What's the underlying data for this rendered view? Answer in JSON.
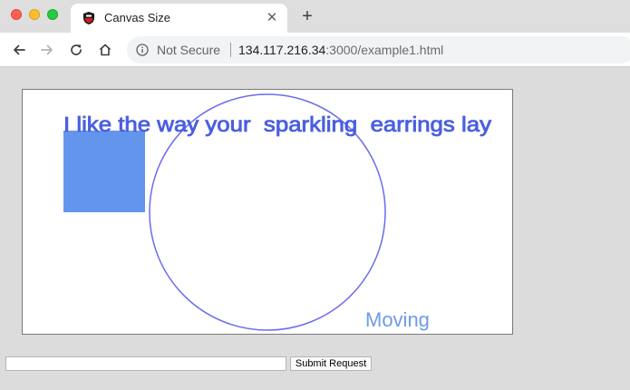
{
  "browser": {
    "tab_title": "Canvas Size",
    "tab_close_glyph": "✕",
    "new_tab_glyph": "+",
    "security_label": "Not Secure",
    "url_host": "134.117.216.34",
    "url_rest": ":3000/example1.html"
  },
  "canvas": {
    "caption_text": "I like the way your  sparkling  earrings lay",
    "moving_text": "Moving",
    "colors": {
      "caption": "#4a5fe0",
      "square": "#6495ed",
      "circle": "#6b6bf0",
      "moving": "#6f9be8"
    }
  },
  "form": {
    "input_value": "",
    "input_placeholder": "",
    "submit_label": "Submit Request"
  },
  "icons": {
    "back": "arrow-left-icon",
    "forward": "arrow-right-icon",
    "reload": "reload-icon",
    "home": "home-icon",
    "info": "info-icon",
    "favicon": "shield-favicon-icon"
  }
}
